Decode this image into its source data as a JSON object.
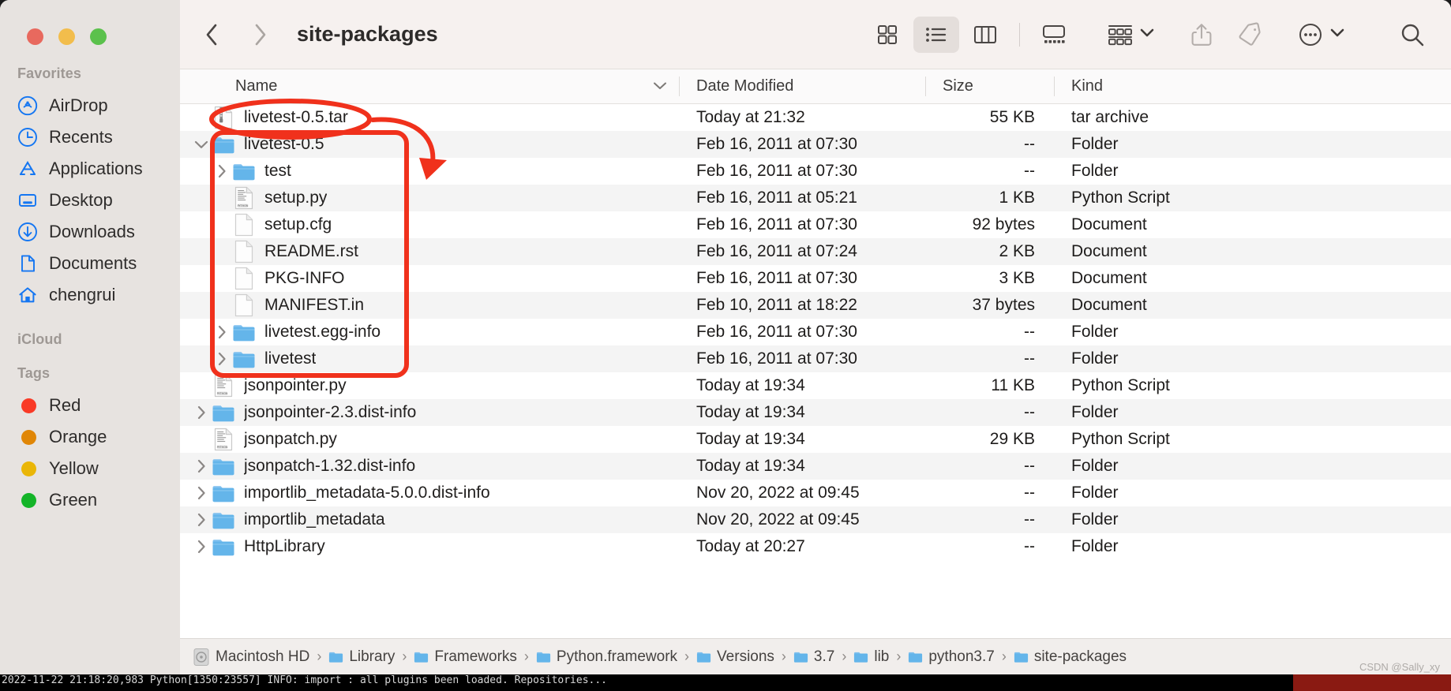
{
  "window": {
    "title": "site-packages",
    "traffic_lights": [
      "close-red",
      "minimize-yellow",
      "zoom-green"
    ]
  },
  "toolbar": {
    "back_label": "Back",
    "forward_label": "Forward",
    "view_icon_label": "Icon View",
    "view_list_label": "List View",
    "view_column_label": "Column View",
    "view_gallery_label": "Gallery View",
    "group_label": "Group",
    "share_label": "Share",
    "tags_label": "Tags",
    "more_label": "More",
    "search_label": "Search"
  },
  "sidebar": {
    "sections": [
      {
        "title": "Favorites",
        "items": [
          {
            "label": "AirDrop",
            "icon": "airdrop-icon"
          },
          {
            "label": "Recents",
            "icon": "clock-icon"
          },
          {
            "label": "Applications",
            "icon": "applications-icon"
          },
          {
            "label": "Desktop",
            "icon": "desktop-icon"
          },
          {
            "label": "Downloads",
            "icon": "downloads-icon"
          },
          {
            "label": "Documents",
            "icon": "document-icon"
          },
          {
            "label": "chengrui",
            "icon": "home-icon"
          }
        ]
      },
      {
        "title": "iCloud",
        "items": []
      },
      {
        "title": "Tags",
        "items": [
          {
            "label": "Red",
            "icon": "tag-dot",
            "color": "#f93a26"
          },
          {
            "label": "Orange",
            "icon": "tag-dot",
            "color": "#e08606"
          },
          {
            "label": "Yellow",
            "icon": "tag-dot",
            "color": "#eab607"
          },
          {
            "label": "Green",
            "icon": "tag-dot",
            "color": "#14b428"
          }
        ]
      }
    ]
  },
  "columns": {
    "name": "Name",
    "date_modified": "Date Modified",
    "size": "Size",
    "kind": "Kind"
  },
  "files": [
    {
      "name": "livetest-0.5.tar",
      "date": "Today at 21:32",
      "size": "55 KB",
      "kind": "tar archive",
      "icon": "archive-icon",
      "indent": 0,
      "twisty": "none",
      "alt": false
    },
    {
      "name": "livetest-0.5",
      "date": "Feb 16, 2011 at 07:30",
      "size": "--",
      "kind": "Folder",
      "icon": "folder-icon",
      "indent": 0,
      "twisty": "down",
      "alt": true
    },
    {
      "name": "test",
      "date": "Feb 16, 2011 at 07:30",
      "size": "--",
      "kind": "Folder",
      "icon": "folder-icon",
      "indent": 1,
      "twisty": "right",
      "alt": false
    },
    {
      "name": "setup.py",
      "date": "Feb 16, 2011 at 05:21",
      "size": "1 KB",
      "kind": "Python Script",
      "icon": "python-icon",
      "indent": 1,
      "twisty": "none",
      "alt": true
    },
    {
      "name": "setup.cfg",
      "date": "Feb 16, 2011 at 07:30",
      "size": "92 bytes",
      "kind": "Document",
      "icon": "doc-icon",
      "indent": 1,
      "twisty": "none",
      "alt": false
    },
    {
      "name": "README.rst",
      "date": "Feb 16, 2011 at 07:24",
      "size": "2 KB",
      "kind": "Document",
      "icon": "doc-icon",
      "indent": 1,
      "twisty": "none",
      "alt": true
    },
    {
      "name": "PKG-INFO",
      "date": "Feb 16, 2011 at 07:30",
      "size": "3 KB",
      "kind": "Document",
      "icon": "doc-icon",
      "indent": 1,
      "twisty": "none",
      "alt": false
    },
    {
      "name": "MANIFEST.in",
      "date": "Feb 10, 2011 at 18:22",
      "size": "37 bytes",
      "kind": "Document",
      "icon": "doc-icon",
      "indent": 1,
      "twisty": "none",
      "alt": true
    },
    {
      "name": "livetest.egg-info",
      "date": "Feb 16, 2011 at 07:30",
      "size": "--",
      "kind": "Folder",
      "icon": "folder-icon",
      "indent": 1,
      "twisty": "right",
      "alt": false
    },
    {
      "name": "livetest",
      "date": "Feb 16, 2011 at 07:30",
      "size": "--",
      "kind": "Folder",
      "icon": "folder-icon",
      "indent": 1,
      "twisty": "right",
      "alt": true
    },
    {
      "name": "jsonpointer.py",
      "date": "Today at 19:34",
      "size": "11 KB",
      "kind": "Python Script",
      "icon": "python-icon",
      "indent": 0,
      "twisty": "none",
      "alt": false
    },
    {
      "name": "jsonpointer-2.3.dist-info",
      "date": "Today at 19:34",
      "size": "--",
      "kind": "Folder",
      "icon": "folder-icon",
      "indent": 0,
      "twisty": "right",
      "alt": true
    },
    {
      "name": "jsonpatch.py",
      "date": "Today at 19:34",
      "size": "29 KB",
      "kind": "Python Script",
      "icon": "python-icon",
      "indent": 0,
      "twisty": "none",
      "alt": false
    },
    {
      "name": "jsonpatch-1.32.dist-info",
      "date": "Today at 19:34",
      "size": "--",
      "kind": "Folder",
      "icon": "folder-icon",
      "indent": 0,
      "twisty": "right",
      "alt": true
    },
    {
      "name": "importlib_metadata-5.0.0.dist-info",
      "date": "Nov 20, 2022 at 09:45",
      "size": "--",
      "kind": "Folder",
      "icon": "folder-icon",
      "indent": 0,
      "twisty": "right",
      "alt": false
    },
    {
      "name": "importlib_metadata",
      "date": "Nov 20, 2022 at 09:45",
      "size": "--",
      "kind": "Folder",
      "icon": "folder-icon",
      "indent": 0,
      "twisty": "right",
      "alt": true
    },
    {
      "name": "HttpLibrary",
      "date": "Today at 20:27",
      "size": "--",
      "kind": "Folder",
      "icon": "folder-icon",
      "indent": 0,
      "twisty": "right",
      "alt": false
    }
  ],
  "path_bar": {
    "crumbs": [
      {
        "label": "Macintosh HD",
        "icon": "disk-icon"
      },
      {
        "label": "Library",
        "icon": "folder-icon"
      },
      {
        "label": "Frameworks",
        "icon": "folder-icon"
      },
      {
        "label": "Python.framework",
        "icon": "folder-icon"
      },
      {
        "label": "Versions",
        "icon": "folder-icon"
      },
      {
        "label": "3.7",
        "icon": "folder-icon"
      },
      {
        "label": "lib",
        "icon": "folder-icon"
      },
      {
        "label": "python3.7",
        "icon": "folder-icon"
      },
      {
        "label": "site-packages",
        "icon": "folder-icon"
      }
    ],
    "separator": "›"
  },
  "watermark": "CSDN @Sally_xy",
  "terminal": {
    "line": "2022-11-22 21:18:20,983 Python[1350:23557] INFO: import : all plugins been loaded. Repositories..."
  },
  "annotation": {
    "color": "#f0311c",
    "shapes": [
      "ellipse-around-tar-file",
      "rounded-rect-around-extracted-contents",
      "curved-arrow"
    ]
  }
}
